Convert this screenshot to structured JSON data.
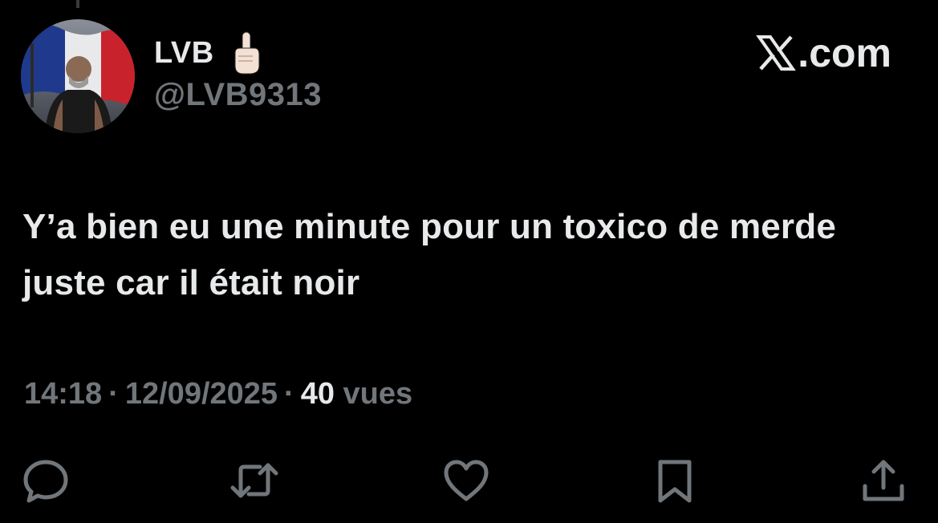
{
  "author": {
    "display_name": "LVB",
    "name_emoji": "index-pointing-up-emoji",
    "handle": "@LVB9313",
    "avatar": "avatar-man-french-flag"
  },
  "brand": {
    "text": ".com",
    "icon": "x-logo-icon"
  },
  "tweet": {
    "text": "Y’a bien eu une minute pour un toxico de merde juste car il était noir"
  },
  "meta": {
    "time": "14:18",
    "date": "12/09/2025",
    "views_count": "40",
    "views_label": "vues",
    "separator": "·"
  },
  "actions": [
    {
      "name": "reply",
      "icon": "reply-icon"
    },
    {
      "name": "repost",
      "icon": "repost-icon"
    },
    {
      "name": "like",
      "icon": "heart-icon"
    },
    {
      "name": "bookmark",
      "icon": "bookmark-icon"
    },
    {
      "name": "share",
      "icon": "share-icon"
    }
  ],
  "colors": {
    "background": "#000000",
    "primary_text": "#e7e9ea",
    "secondary_text": "#71767b"
  }
}
